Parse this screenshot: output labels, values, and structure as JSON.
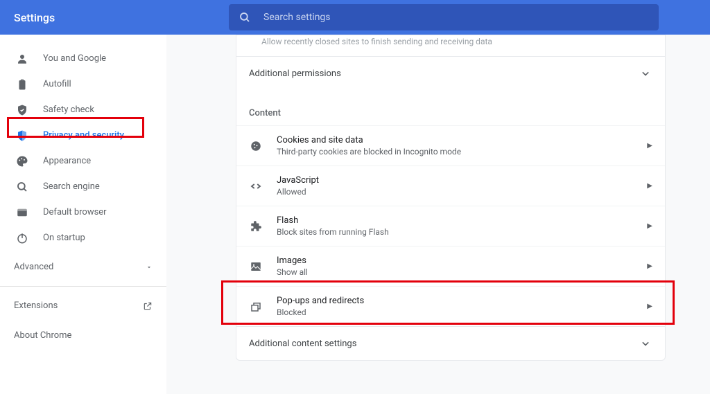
{
  "header": {
    "title": "Settings",
    "search_placeholder": "Search settings"
  },
  "sidebar": {
    "items": [
      {
        "label": "You and Google"
      },
      {
        "label": "Autofill"
      },
      {
        "label": "Safety check"
      },
      {
        "label": "Privacy and security"
      },
      {
        "label": "Appearance"
      },
      {
        "label": "Search engine"
      },
      {
        "label": "Default browser"
      },
      {
        "label": "On startup"
      }
    ],
    "advanced": "Advanced",
    "extensions": "Extensions",
    "about": "About Chrome"
  },
  "main": {
    "faded": "Allow recently closed sites to finish sending and receiving data",
    "additional_permissions": "Additional permissions",
    "content_title": "Content",
    "rows": [
      {
        "title": "Cookies and site data",
        "sub": "Third-party cookies are blocked in Incognito mode"
      },
      {
        "title": "JavaScript",
        "sub": "Allowed"
      },
      {
        "title": "Flash",
        "sub": "Block sites from running Flash"
      },
      {
        "title": "Images",
        "sub": "Show all"
      },
      {
        "title": "Pop-ups and redirects",
        "sub": "Blocked"
      }
    ],
    "additional_content": "Additional content settings"
  }
}
